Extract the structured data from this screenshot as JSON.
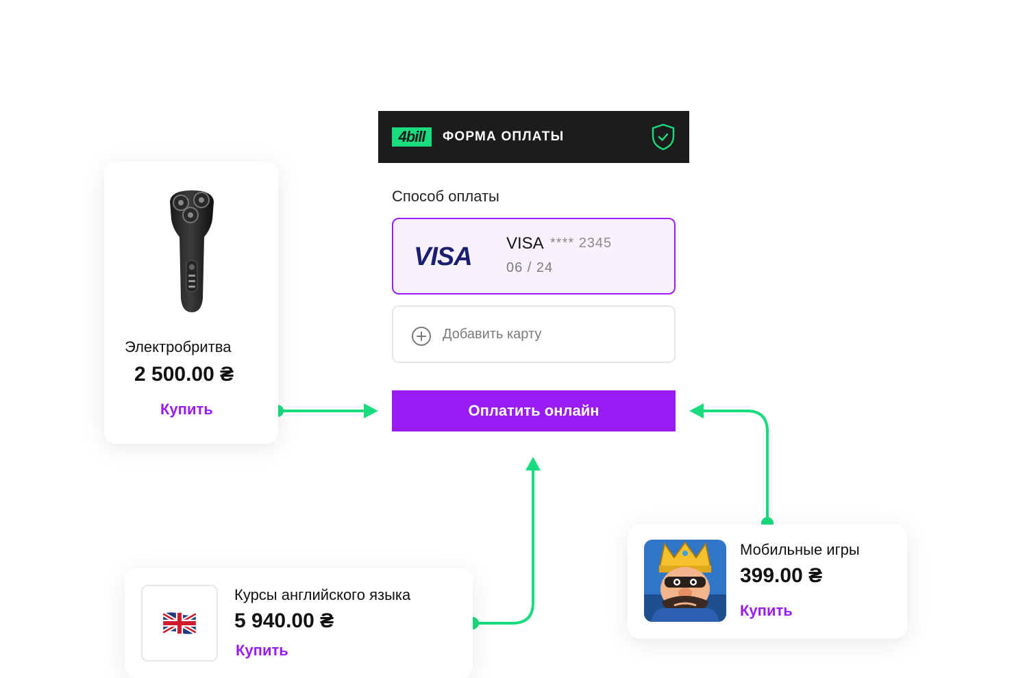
{
  "payment_form": {
    "brand": "4bill",
    "title": "ФОРМА ОПЛАТЫ",
    "method_label": "Способ оплаты",
    "saved_card": {
      "brand_logo": "VISA",
      "name": "VISA",
      "masked_number": "**** 2345",
      "expiry": "06 / 24"
    },
    "add_card_label": "Добавить карту",
    "pay_button_label": "Оплатить онлайн"
  },
  "products": {
    "shaver": {
      "name": "Электробритва",
      "price": "2 500.00 ₴",
      "buy_label": "Купить",
      "icon": "electric-shaver"
    },
    "english": {
      "name": "Курсы английского языка",
      "price": "5 940.00 ₴",
      "buy_label": "Купить",
      "icon": "uk-flag"
    },
    "games": {
      "name": "Мобильные игры",
      "price": "399.00 ₴",
      "buy_label": "Купить",
      "icon": "game-king"
    }
  },
  "colors": {
    "accent": "#9a1cf5",
    "connector": "#18dc7d",
    "header_bg": "#1c1c1c",
    "selected_card_bg": "#f8f2fd",
    "visa_blue": "#1a1f71"
  }
}
